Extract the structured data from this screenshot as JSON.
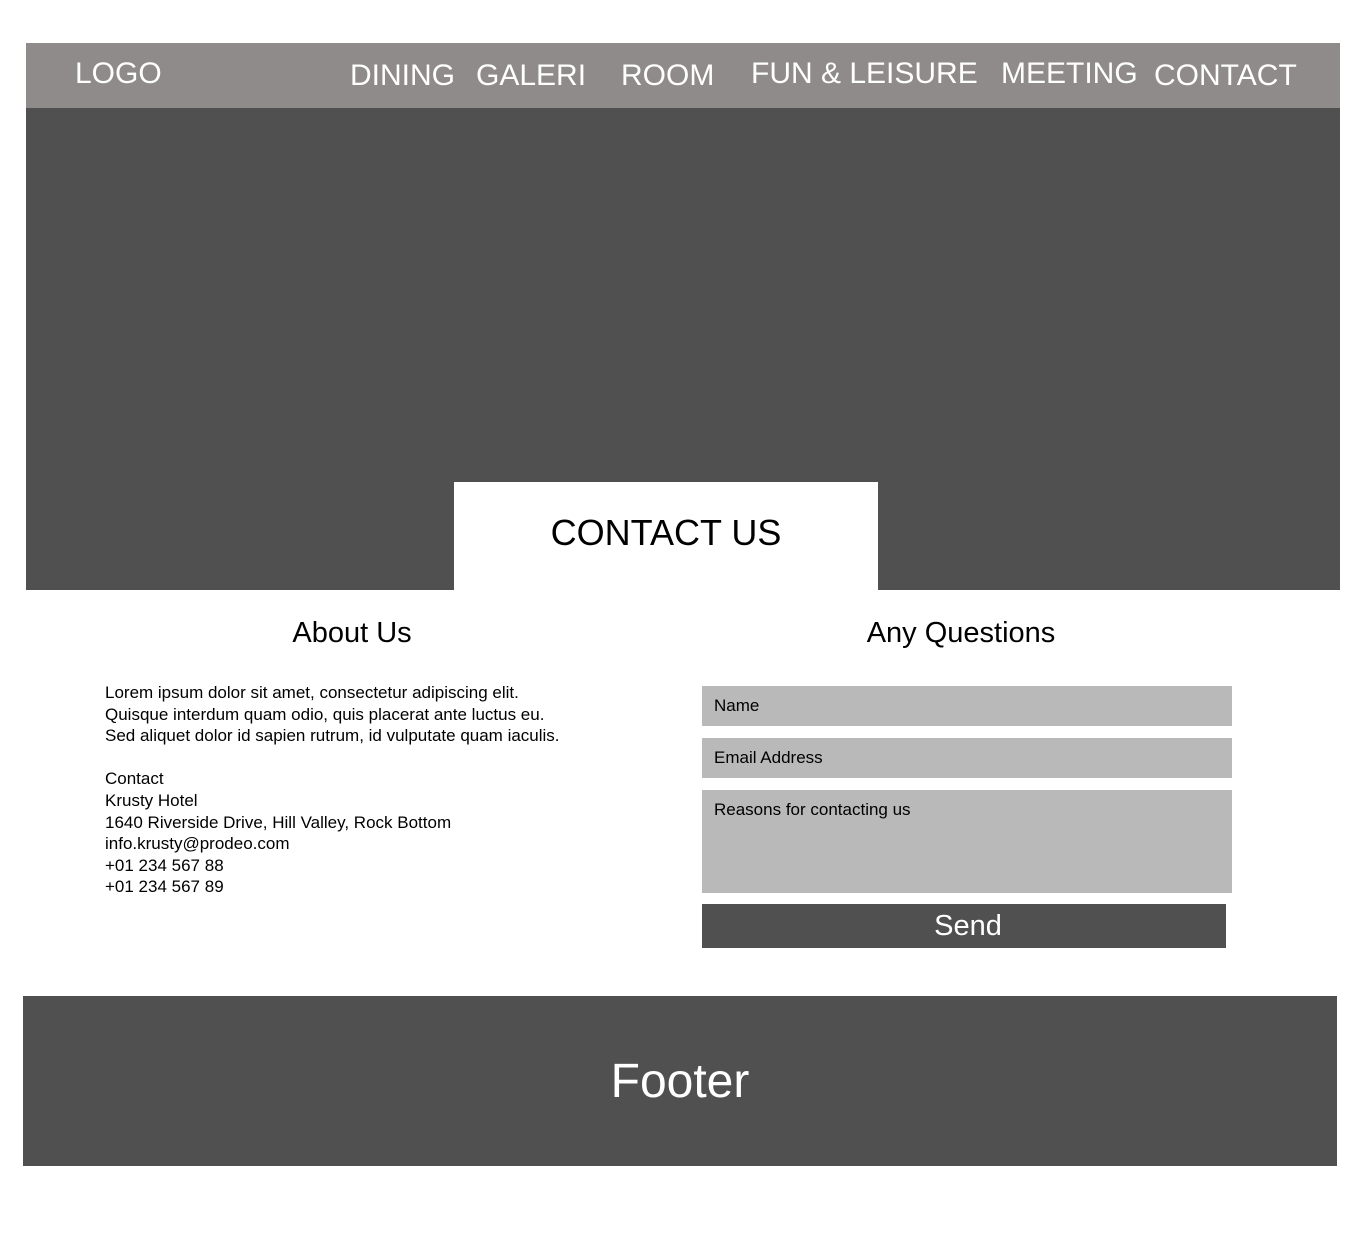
{
  "nav": {
    "logo": "LOGO",
    "items": [
      {
        "label": "DINING"
      },
      {
        "label": "GALERI"
      },
      {
        "label": "ROOM"
      },
      {
        "label": "FUN & LEISURE"
      },
      {
        "label": "MEETING"
      },
      {
        "label": "CONTACT"
      }
    ]
  },
  "hero": {
    "title": "CONTACT US"
  },
  "about": {
    "heading": "About Us",
    "paragraph_lines": [
      "Lorem ipsum dolor sit amet, consectetur adipiscing elit.",
      "Quisque interdum quam odio, quis placerat ante luctus eu.",
      "Sed aliquet dolor id sapien rutrum, id vulputate quam iaculis."
    ],
    "contact_lines": [
      "Contact",
      "Krusty Hotel",
      "1640 Riverside Drive, Hill Valley, Rock Bottom",
      "info.krusty@prodeo.com",
      "+01 234 567 88",
      "+01 234 567 89"
    ]
  },
  "form": {
    "heading": "Any Questions",
    "name_placeholder": "Name",
    "email_placeholder": "Email Address",
    "reason_placeholder": "Reasons for contacting us",
    "send_label": "Send"
  },
  "footer": {
    "text": "Footer"
  },
  "colors": {
    "navbar": "#8f8b8b",
    "dark_gray": "#505050",
    "field_gray": "#b9b9b9",
    "text_light": "#ffffff",
    "text_dark": "#000000"
  }
}
